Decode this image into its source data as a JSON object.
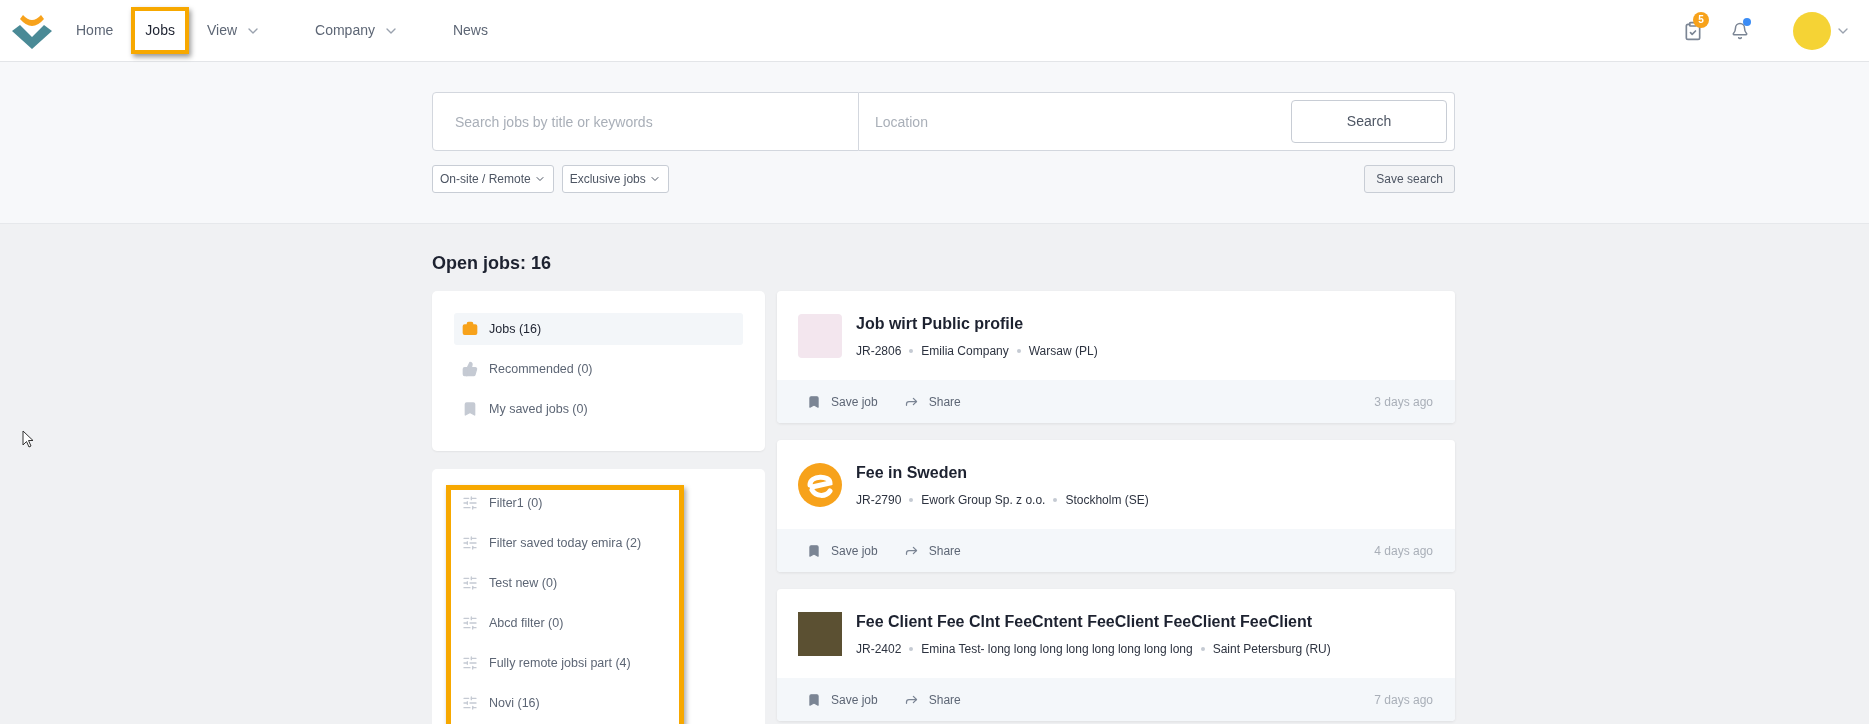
{
  "nav": {
    "items": [
      {
        "label": "Home",
        "kind": "link",
        "selected": false,
        "annotated": false
      },
      {
        "label": "Jobs",
        "kind": "link",
        "selected": true,
        "annotated": true
      },
      {
        "label": "View",
        "kind": "dropdown",
        "selected": false,
        "annotated": false
      },
      {
        "label": "Company",
        "kind": "dropdown",
        "selected": false,
        "annotated": false
      },
      {
        "label": "News",
        "kind": "link",
        "selected": false,
        "annotated": false
      }
    ],
    "tasks_badge": "5",
    "notifications_unread": true
  },
  "search": {
    "keywords_placeholder": "Search jobs by title or keywords",
    "location_placeholder": "Location",
    "button": "Search",
    "filters": [
      "On-site / Remote",
      "Exclusive jobs"
    ],
    "save_button": "Save search"
  },
  "heading": "Open jobs: 16",
  "sidebar": {
    "items": [
      {
        "label": "Jobs (16)",
        "kind": "briefcase",
        "selected": true
      },
      {
        "label": "Recommended (0)",
        "kind": "thumbs",
        "selected": false
      },
      {
        "label": "My saved jobs (0)",
        "kind": "bookmark",
        "selected": false
      }
    ]
  },
  "saved_filters": {
    "annotated": true,
    "items": [
      "Filter1 (0)",
      "Filter saved today emira (2)",
      "Test new (0)",
      "Abcd filter (0)",
      "Fully remote jobsi part (4)",
      "Novi (16)"
    ]
  },
  "jobs": [
    {
      "title": "Job wirt Public profile",
      "meta": [
        "JR-2806",
        "Emilia Company",
        "Warsaw (PL)"
      ],
      "kind": "illustration",
      "save": "Save job",
      "share": "Share",
      "age": "3 days ago"
    },
    {
      "title": "Fee in Sweden",
      "meta": [
        "JR-2790",
        "Ework Group Sp. z o.o.",
        "Stockholm (SE)"
      ],
      "kind": "emblem",
      "save": "Save job",
      "share": "Share",
      "age": "4 days ago"
    },
    {
      "title": "Fee Client Fee Clnt FeeCntent FeeClient FeeClient FeeClient",
      "meta": [
        "JR-2402",
        "Emina Test- long long long long long long long long",
        "Saint Petersburg (RU)"
      ],
      "kind": "photo",
      "save": "Save job",
      "share": "Share",
      "age": "7 days ago"
    }
  ]
}
